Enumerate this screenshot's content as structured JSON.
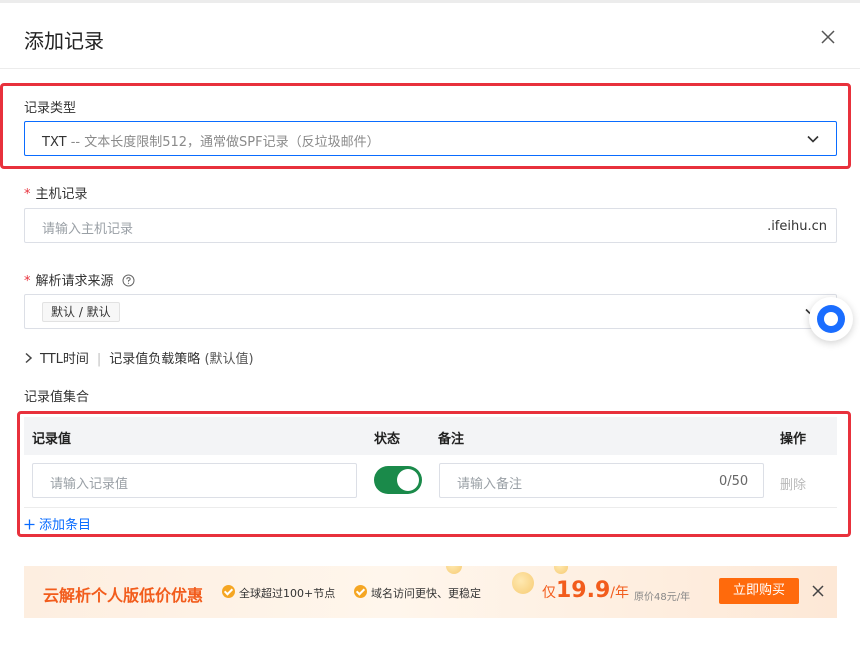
{
  "dialog": {
    "title": "添加记录"
  },
  "record_type": {
    "label": "记录类型",
    "value_type": "TXT",
    "value_desc": "-- 文本长度限制512，通常做SPF记录（反垃圾邮件）"
  },
  "host_record": {
    "label": "主机记录",
    "placeholder": "请输入主机记录",
    "suffix": ".ifeihu.cn"
  },
  "resolve_source": {
    "label": "解析请求来源",
    "tag": "默认 / 默认"
  },
  "advanced": {
    "ttl": "TTL时间",
    "strategy": "记录值负载策略",
    "strategy_default": "(默认值)"
  },
  "record_values": {
    "section_label": "记录值集合",
    "columns": {
      "value": "记录值",
      "status": "状态",
      "remark": "备注",
      "action": "操作"
    },
    "rows": [
      {
        "value_placeholder": "请输入记录值",
        "status_on": true,
        "remark_placeholder": "请输入备注",
        "counter": "0/50",
        "delete": "删除"
      }
    ],
    "add_label": "添加条目"
  },
  "banner": {
    "title": "云解析个人版低价优惠",
    "feature1": "全球超过100+节点",
    "feature2": "域名访问更快、更稳定",
    "price_prefix": "仅",
    "price": "19.9",
    "price_unit": "/年",
    "original_price": "原价48元/年",
    "buy_label": "立即购买"
  },
  "colors": {
    "accent": "#0a6cff",
    "highlight_border": "#e8313c",
    "toggle_on": "#1a8a4a",
    "promo": "#f25c1c"
  },
  "icons": [
    "close-icon",
    "chevron-down-icon",
    "help-circle-icon",
    "chevron-right-icon",
    "plus-icon",
    "check-circle-icon",
    "assistant-icon"
  ]
}
